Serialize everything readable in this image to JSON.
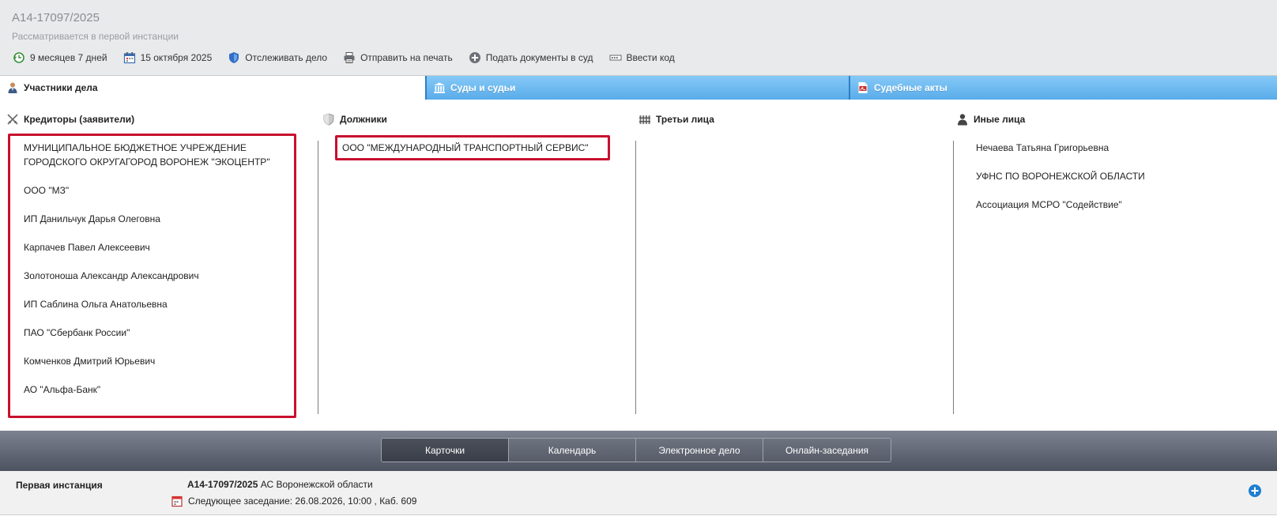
{
  "header": {
    "case_number": "А14-17097/2025",
    "status": "Рассматривается в первой инстанции",
    "tools": [
      {
        "label": "9 месяцев 7 дней",
        "icon": "clock-arrow-icon"
      },
      {
        "label": "15 октября 2025",
        "icon": "calendar-icon"
      },
      {
        "label": "Отслеживать дело",
        "icon": "shield-icon"
      },
      {
        "label": "Отправить на печать",
        "icon": "printer-icon"
      },
      {
        "label": "Подать документы в суд",
        "icon": "plus-circle-icon"
      },
      {
        "label": "Ввести код",
        "icon": "code-entry-icon"
      }
    ]
  },
  "tabs": [
    {
      "label": "Участники дела",
      "icon": "person-icon",
      "active": true
    },
    {
      "label": "Суды и судьи",
      "icon": "court-building-icon",
      "active": false
    },
    {
      "label": "Судебные акты",
      "icon": "pdf-document-icon",
      "active": false
    }
  ],
  "columns": {
    "creditors": {
      "title": "Кредиторы (заявители)",
      "icon": "crossed-swords-icon",
      "items": [
        "МУНИЦИПАЛЬНОЕ БЮДЖЕТНОЕ УЧРЕЖДЕНИЕ ГОРОДСКОГО ОКРУГАГОРОД ВОРОНЕЖ \"ЭКОЦЕНТР\"",
        "ООО \"МЗ\"",
        "ИП Данильчук Дарья Олеговна",
        "Карпачев Павел Алексеевич",
        "Золотоноша Александр Александрович",
        "ИП Саблина Ольга Анатольевна",
        "ПАО \"Сбербанк России\"",
        "Комченков Дмитрий Юрьевич",
        "АО \"Альфа-Банк\""
      ]
    },
    "debtors": {
      "title": "Должники",
      "icon": "shield-icon",
      "items": [
        "ООО \"МЕЖДУНАРОДНЫЙ ТРАНСПОРТНЫЙ СЕРВИС\""
      ]
    },
    "third_parties": {
      "title": "Третьи лица",
      "icon": "fence-icon",
      "items": []
    },
    "others": {
      "title": "Иные лица",
      "icon": "person-silhouette-icon",
      "items": [
        "Нечаева Татьяна Григорьевна",
        "УФНС ПО ВОРОНЕЖСКОЙ ОБЛАСТИ",
        "Ассоциация МСРО \"Содействие\""
      ]
    }
  },
  "bottom_tabs": [
    {
      "label": "Карточки",
      "active": true
    },
    {
      "label": "Календарь",
      "active": false
    },
    {
      "label": "Электронное дело",
      "active": false
    },
    {
      "label": "Онлайн-заседания",
      "active": false
    }
  ],
  "instance": {
    "label": "Первая инстанция",
    "case_number": "А14-17097/2025",
    "court": "АС Воронежской области",
    "next_hearing": "Следующее заседание: 26.08.2026, 10:00 , Каб. 609"
  },
  "colors": {
    "highlight": "#c8102e",
    "tab_blue": "#59acea",
    "header_bg": "#e9eaec",
    "bottom_bar": "#5a5f6c"
  }
}
